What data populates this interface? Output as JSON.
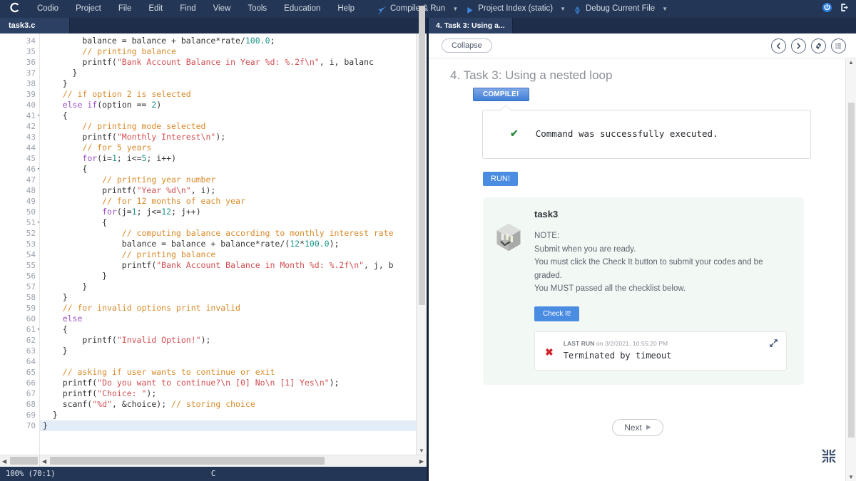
{
  "menubar": {
    "logo": "C",
    "items": [
      "Codio",
      "Project",
      "File",
      "Edit",
      "Find",
      "View",
      "Tools",
      "Education",
      "Help"
    ],
    "tools": [
      {
        "label": "Compile & Run",
        "icon": "rocket-icon",
        "caret": "▼"
      },
      {
        "label": "Project Index (static)",
        "icon": "play-icon",
        "caret": "▼"
      },
      {
        "label": "Debug Current File",
        "icon": "debug-icon",
        "caret": "▼"
      }
    ],
    "right_icons": [
      {
        "name": "power-icon",
        "color": "#2f7fe0"
      },
      {
        "name": "logout-icon",
        "color": "#e8edf4"
      }
    ]
  },
  "editor": {
    "tab_label": "task3.c",
    "first_line": 34,
    "highlight_line": 70,
    "fold_lines": [
      41,
      46,
      51,
      61
    ],
    "lines": [
      {
        "n": 34,
        "tokens": [
          {
            "t": "        balance = balance + balance*rate/",
            "c": "pln"
          },
          {
            "t": "100.0",
            "c": "num"
          },
          {
            "t": ";",
            "c": "pln"
          }
        ]
      },
      {
        "n": 35,
        "tokens": [
          {
            "t": "        // printing balance",
            "c": "cmt"
          }
        ]
      },
      {
        "n": 36,
        "tokens": [
          {
            "t": "        printf(",
            "c": "pln"
          },
          {
            "t": "\"Bank Account Balance in Year %d: %.2f\\n\"",
            "c": "str"
          },
          {
            "t": ", i, balanc",
            "c": "pln"
          }
        ]
      },
      {
        "n": 37,
        "tokens": [
          {
            "t": "      }",
            "c": "pln"
          }
        ]
      },
      {
        "n": 38,
        "tokens": [
          {
            "t": "    }",
            "c": "pln"
          }
        ]
      },
      {
        "n": 39,
        "tokens": [
          {
            "t": "    // if option 2 is selected",
            "c": "cmt"
          }
        ]
      },
      {
        "n": 40,
        "tokens": [
          {
            "t": "    ",
            "c": "pln"
          },
          {
            "t": "else",
            "c": "kw"
          },
          {
            "t": " ",
            "c": "pln"
          },
          {
            "t": "if",
            "c": "kw"
          },
          {
            "t": "(option == ",
            "c": "pln"
          },
          {
            "t": "2",
            "c": "num"
          },
          {
            "t": ")",
            "c": "pln"
          }
        ]
      },
      {
        "n": 41,
        "tokens": [
          {
            "t": "    {",
            "c": "pln"
          }
        ]
      },
      {
        "n": 42,
        "tokens": [
          {
            "t": "        // printing mode selected",
            "c": "cmt"
          }
        ]
      },
      {
        "n": 43,
        "tokens": [
          {
            "t": "        printf(",
            "c": "pln"
          },
          {
            "t": "\"Monthly Interest\\n\"",
            "c": "str"
          },
          {
            "t": ");",
            "c": "pln"
          }
        ]
      },
      {
        "n": 44,
        "tokens": [
          {
            "t": "        // for 5 years",
            "c": "cmt"
          }
        ]
      },
      {
        "n": 45,
        "tokens": [
          {
            "t": "        ",
            "c": "pln"
          },
          {
            "t": "for",
            "c": "kw"
          },
          {
            "t": "(i=",
            "c": "pln"
          },
          {
            "t": "1",
            "c": "num"
          },
          {
            "t": "; i<=",
            "c": "pln"
          },
          {
            "t": "5",
            "c": "num"
          },
          {
            "t": "; i++)",
            "c": "pln"
          }
        ]
      },
      {
        "n": 46,
        "tokens": [
          {
            "t": "        {",
            "c": "pln"
          }
        ]
      },
      {
        "n": 47,
        "tokens": [
          {
            "t": "            // printing year number",
            "c": "cmt"
          }
        ]
      },
      {
        "n": 48,
        "tokens": [
          {
            "t": "            printf(",
            "c": "pln"
          },
          {
            "t": "\"Year %d\\n\"",
            "c": "str"
          },
          {
            "t": ", i);",
            "c": "pln"
          }
        ]
      },
      {
        "n": 49,
        "tokens": [
          {
            "t": "            // for 12 months of each year",
            "c": "cmt"
          }
        ]
      },
      {
        "n": 50,
        "tokens": [
          {
            "t": "            ",
            "c": "pln"
          },
          {
            "t": "for",
            "c": "kw"
          },
          {
            "t": "(j=",
            "c": "pln"
          },
          {
            "t": "1",
            "c": "num"
          },
          {
            "t": "; j<=",
            "c": "pln"
          },
          {
            "t": "12",
            "c": "num"
          },
          {
            "t": "; j++)",
            "c": "pln"
          }
        ]
      },
      {
        "n": 51,
        "tokens": [
          {
            "t": "            {",
            "c": "pln"
          }
        ]
      },
      {
        "n": 52,
        "tokens": [
          {
            "t": "                // computing balance according to monthly interest rate",
            "c": "cmt"
          }
        ]
      },
      {
        "n": 53,
        "tokens": [
          {
            "t": "                balance = balance + balance*rate/(",
            "c": "pln"
          },
          {
            "t": "12",
            "c": "num"
          },
          {
            "t": "*",
            "c": "pln"
          },
          {
            "t": "100.0",
            "c": "num"
          },
          {
            "t": ");",
            "c": "pln"
          }
        ]
      },
      {
        "n": 54,
        "tokens": [
          {
            "t": "                // printing balance",
            "c": "cmt"
          }
        ]
      },
      {
        "n": 55,
        "tokens": [
          {
            "t": "                printf(",
            "c": "pln"
          },
          {
            "t": "\"Bank Account Balance in Month %d: %.2f\\n\"",
            "c": "str"
          },
          {
            "t": ", j, b",
            "c": "pln"
          }
        ]
      },
      {
        "n": 56,
        "tokens": [
          {
            "t": "            }",
            "c": "pln"
          }
        ]
      },
      {
        "n": 57,
        "tokens": [
          {
            "t": "        }",
            "c": "pln"
          }
        ]
      },
      {
        "n": 58,
        "tokens": [
          {
            "t": "    }",
            "c": "pln"
          }
        ]
      },
      {
        "n": 59,
        "tokens": [
          {
            "t": "    // for invalid options print invalid",
            "c": "cmt"
          }
        ]
      },
      {
        "n": 60,
        "tokens": [
          {
            "t": "    ",
            "c": "pln"
          },
          {
            "t": "else",
            "c": "kw"
          }
        ]
      },
      {
        "n": 61,
        "tokens": [
          {
            "t": "    {",
            "c": "pln"
          }
        ]
      },
      {
        "n": 62,
        "tokens": [
          {
            "t": "        printf(",
            "c": "pln"
          },
          {
            "t": "\"Invalid Option!\"",
            "c": "str"
          },
          {
            "t": ");",
            "c": "pln"
          }
        ]
      },
      {
        "n": 63,
        "tokens": [
          {
            "t": "    }",
            "c": "pln"
          }
        ]
      },
      {
        "n": 64,
        "tokens": [
          {
            "t": "",
            "c": "pln"
          }
        ]
      },
      {
        "n": 65,
        "tokens": [
          {
            "t": "    // asking if user wants to continue or exit",
            "c": "cmt"
          }
        ]
      },
      {
        "n": 66,
        "tokens": [
          {
            "t": "    printf(",
            "c": "pln"
          },
          {
            "t": "\"Do you want to continue?\\n [0] No\\n [1] Yes\\n\"",
            "c": "str"
          },
          {
            "t": ");",
            "c": "pln"
          }
        ]
      },
      {
        "n": 67,
        "tokens": [
          {
            "t": "    printf(",
            "c": "pln"
          },
          {
            "t": "\"Choice: \"",
            "c": "str"
          },
          {
            "t": ");",
            "c": "pln"
          }
        ]
      },
      {
        "n": 68,
        "tokens": [
          {
            "t": "    scanf(",
            "c": "pln"
          },
          {
            "t": "\"%d\"",
            "c": "str"
          },
          {
            "t": ", &choice); ",
            "c": "pln"
          },
          {
            "t": "// storing choice",
            "c": "cmt"
          }
        ]
      },
      {
        "n": 69,
        "tokens": [
          {
            "t": "  }",
            "c": "pln"
          }
        ]
      },
      {
        "n": 70,
        "tokens": [
          {
            "t": "}",
            "c": "pln"
          }
        ]
      }
    ],
    "status": {
      "zoom": "100%",
      "cursor": "(70:1)",
      "language": "C"
    }
  },
  "guide": {
    "tab_label": "4. Task 3: Using a...",
    "collapse_label": "Collapse",
    "toolbar_icons": [
      "prev-icon",
      "next-icon",
      "gear-icon",
      "list-icon"
    ],
    "title": "4. Task 3: Using a nested loop",
    "compile_button": "COMPILE!",
    "compile_result": "Command was successfully executed.",
    "compile_check": "✔",
    "run_button": "RUN!",
    "task": {
      "name": "task3",
      "note_lines": [
        "NOTE:",
        "Submit when you are ready.",
        "You must click the Check It button to submit your codes and be",
        "graded.",
        "You MUST passed all the checklist below."
      ],
      "check_button": "Check It!",
      "last_run_prefix": "LAST RUN",
      "last_run_suffix": " on 3/2/2021, 10:55:20 PM",
      "last_run_status_icon": "✖",
      "last_run_message": "Terminated by timeout"
    },
    "next_button": "Next",
    "next_icon": "▶"
  },
  "colors": {
    "chrome": "#243655",
    "tab_active": "#2c4064",
    "accent_blue": "#4a8ce2",
    "success_green": "#2e8b3d",
    "error_red": "#d0252b",
    "card_green": "#f2f8f3"
  }
}
